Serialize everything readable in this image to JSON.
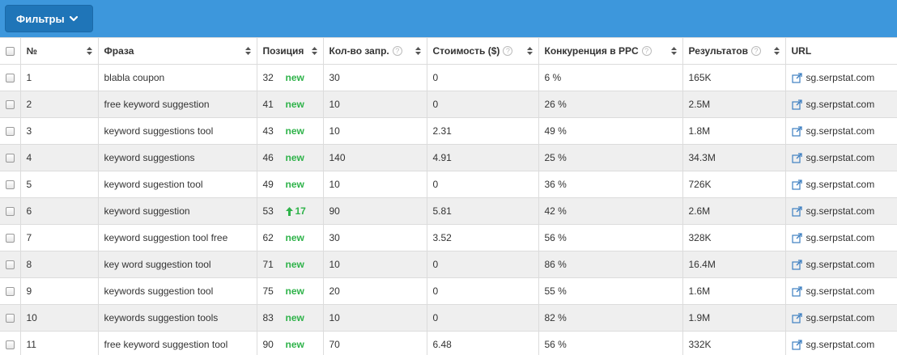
{
  "toolbar": {
    "filter_label": "Фильтры"
  },
  "table": {
    "headers": {
      "num": "№",
      "phrase": "Фраза",
      "position": "Позиция",
      "volume": "Кол-во запр.",
      "cost": "Стоимость ($)",
      "competition": "Конкуренция в PPC",
      "results": "Результатов",
      "url": "URL"
    },
    "rows": [
      {
        "num": "1",
        "phrase": "blabla coupon",
        "position": "32",
        "change": "new",
        "volume": "30",
        "cost": "0",
        "competition": "6 %",
        "results": "165K",
        "url": "sg.serpstat.com"
      },
      {
        "num": "2",
        "phrase": "free keyword suggestion",
        "position": "41",
        "change": "new",
        "volume": "10",
        "cost": "0",
        "competition": "26 %",
        "results": "2.5M",
        "url": "sg.serpstat.com"
      },
      {
        "num": "3",
        "phrase": "keyword suggestions tool",
        "position": "43",
        "change": "new",
        "volume": "10",
        "cost": "2.31",
        "competition": "49 %",
        "results": "1.8M",
        "url": "sg.serpstat.com"
      },
      {
        "num": "4",
        "phrase": "keyword suggestions",
        "position": "46",
        "change": "new",
        "volume": "140",
        "cost": "4.91",
        "competition": "25 %",
        "results": "34.3M",
        "url": "sg.serpstat.com"
      },
      {
        "num": "5",
        "phrase": "keyword sugestion tool",
        "position": "49",
        "change": "new",
        "volume": "10",
        "cost": "0",
        "competition": "36 %",
        "results": "726K",
        "url": "sg.serpstat.com"
      },
      {
        "num": "6",
        "phrase": "keyword suggestion",
        "position": "53",
        "change": "17",
        "change_up": true,
        "volume": "90",
        "cost": "5.81",
        "competition": "42 %",
        "results": "2.6M",
        "url": "sg.serpstat.com"
      },
      {
        "num": "7",
        "phrase": "keyword suggestion tool free",
        "position": "62",
        "change": "new",
        "volume": "30",
        "cost": "3.52",
        "competition": "56 %",
        "results": "328K",
        "url": "sg.serpstat.com"
      },
      {
        "num": "8",
        "phrase": "key word suggestion tool",
        "position": "71",
        "change": "new",
        "volume": "10",
        "cost": "0",
        "competition": "86 %",
        "results": "16.4M",
        "url": "sg.serpstat.com"
      },
      {
        "num": "9",
        "phrase": "keywords suggestion tool",
        "position": "75",
        "change": "new",
        "volume": "20",
        "cost": "0",
        "competition": "55 %",
        "results": "1.6M",
        "url": "sg.serpstat.com"
      },
      {
        "num": "10",
        "phrase": "keywords suggestion tools",
        "position": "83",
        "change": "new",
        "volume": "10",
        "cost": "0",
        "competition": "82 %",
        "results": "1.9M",
        "url": "sg.serpstat.com"
      },
      {
        "num": "11",
        "phrase": "free keyword suggestion tool",
        "position": "90",
        "change": "new",
        "volume": "70",
        "cost": "6.48",
        "competition": "56 %",
        "results": "332K",
        "url": "sg.serpstat.com"
      }
    ]
  },
  "colors": {
    "topbar": "#3d97dc",
    "button": "#1f75b8",
    "positive": "#2fb34a",
    "link_icon": "#3d7fc1"
  },
  "icons": {
    "filter_chevron": "chevron-down-icon",
    "help": "help-icon",
    "sort": "sort-icon",
    "external": "external-link-icon",
    "up_arrow": "arrow-up-icon"
  }
}
